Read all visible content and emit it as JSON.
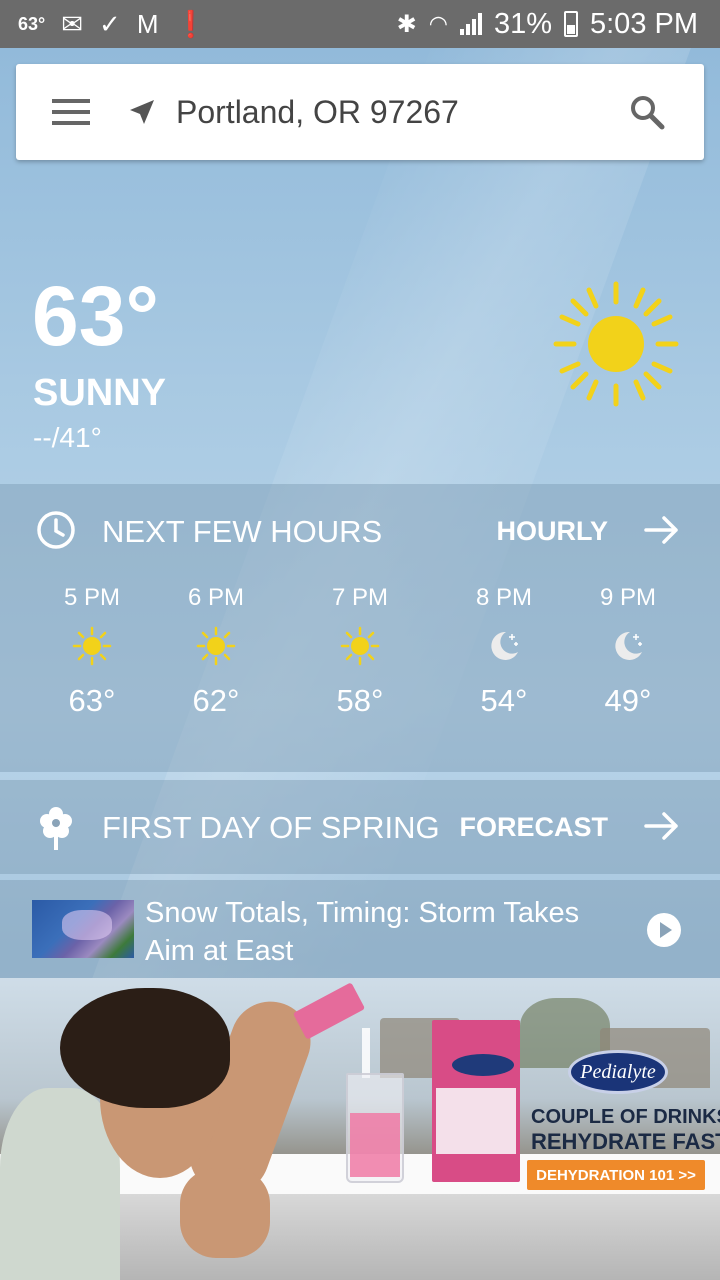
{
  "status_bar": {
    "temperature": "63°",
    "battery": "31%",
    "time": "5:03 PM",
    "icons_left": [
      "mail-icon",
      "checkmark-icon",
      "gmail-icon",
      "alert-icon"
    ],
    "icons_right": [
      "bluetooth-icon",
      "wifi-icon",
      "signal-icon",
      "battery-icon"
    ]
  },
  "search": {
    "location": "Portland, OR 97267"
  },
  "current": {
    "temperature": "63°",
    "condition": "SUNNY",
    "hi_lo": "--/41°",
    "icon": "sun-icon"
  },
  "next_hours": {
    "title": "NEXT FEW HOURS",
    "link": "HOURLY",
    "hours": [
      {
        "time": "5 PM",
        "temp": "63°",
        "icon": "sun"
      },
      {
        "time": "6 PM",
        "temp": "62°",
        "icon": "sun"
      },
      {
        "time": "7 PM",
        "temp": "58°",
        "icon": "sun"
      },
      {
        "time": "8 PM",
        "temp": "54°",
        "icon": "moon"
      },
      {
        "time": "9 PM",
        "temp": "49°",
        "icon": "moon"
      }
    ]
  },
  "season": {
    "title": "FIRST DAY OF SPRING",
    "link": "FORECAST"
  },
  "news": {
    "headline": "Snow Totals, Timing: Storm Takes Aim at East"
  },
  "ad": {
    "brand": "Pedialyte",
    "line1": "COUPLE OF DRINKS?",
    "line2": "REHYDRATE FAST",
    "cta": "DEHYDRATION 101 >>"
  },
  "colors": {
    "sun": "#f2d21a",
    "cta": "#ef8a2a",
    "brand_blue": "#1a3478"
  }
}
